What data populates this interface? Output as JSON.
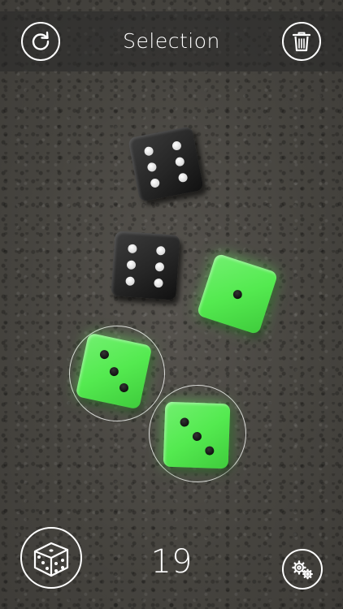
{
  "header": {
    "title": "Selection"
  },
  "footer": {
    "sum": "19"
  },
  "icons": {
    "restart": "restart-icon",
    "trash": "trash-icon",
    "dice": "dice-icon",
    "settings": "gears-icon"
  },
  "colors": {
    "selected_die": "#54ea50",
    "unselected_die": "#262626",
    "bar": "#282828"
  },
  "dice": [
    {
      "value": 6,
      "color": "black",
      "selected": false
    },
    {
      "value": 6,
      "color": "black",
      "selected": false
    },
    {
      "value": 1,
      "color": "green",
      "selected": false
    },
    {
      "value": 3,
      "color": "green",
      "selected": true
    },
    {
      "value": 3,
      "color": "green",
      "selected": true
    }
  ]
}
